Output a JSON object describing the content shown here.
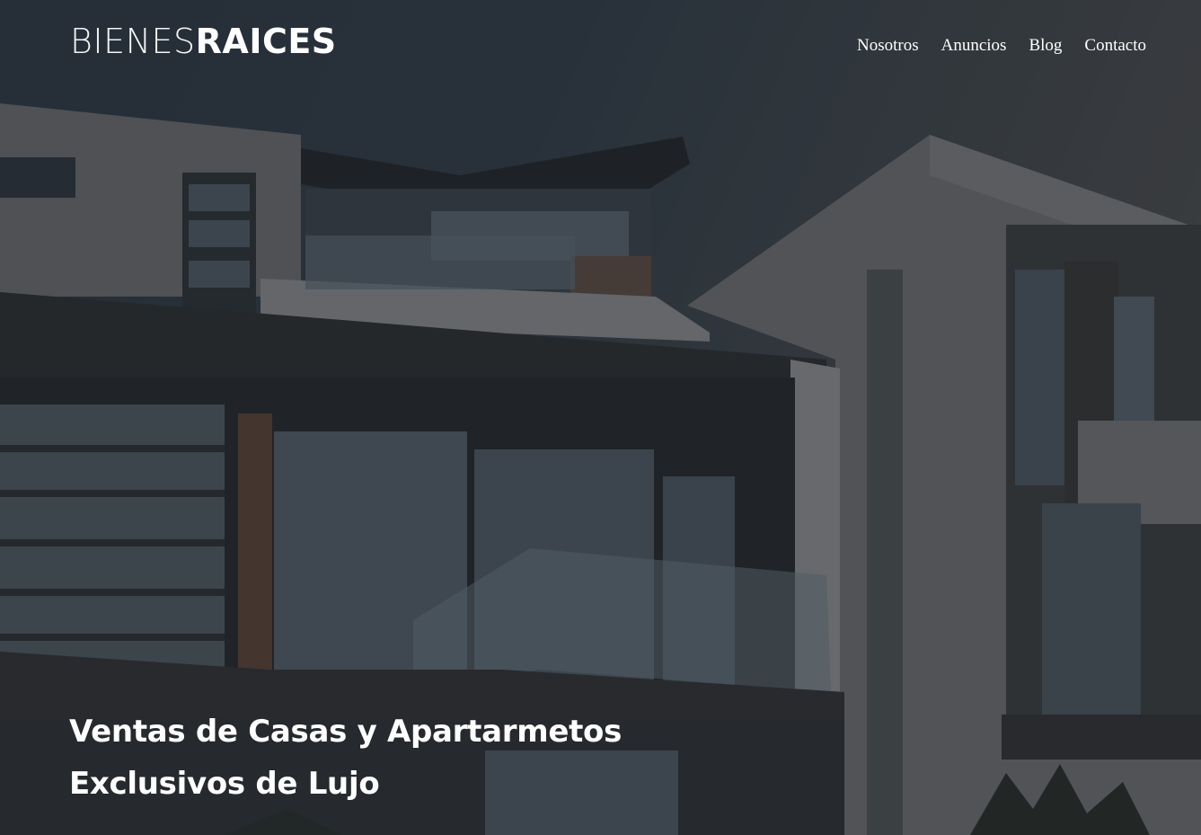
{
  "logo": {
    "part_light": "BIENES",
    "part_bold": "RAICES"
  },
  "nav": {
    "items": [
      {
        "label": "Nosotros"
      },
      {
        "label": "Anuncios"
      },
      {
        "label": "Blog"
      },
      {
        "label": "Contacto"
      }
    ]
  },
  "hero": {
    "headline_line1": "Ventas de Casas y Apartarmetos",
    "headline_line2": "Exclusivos de Lujo"
  },
  "colors": {
    "text": "#ffffff",
    "overlay": "#1e2228"
  }
}
